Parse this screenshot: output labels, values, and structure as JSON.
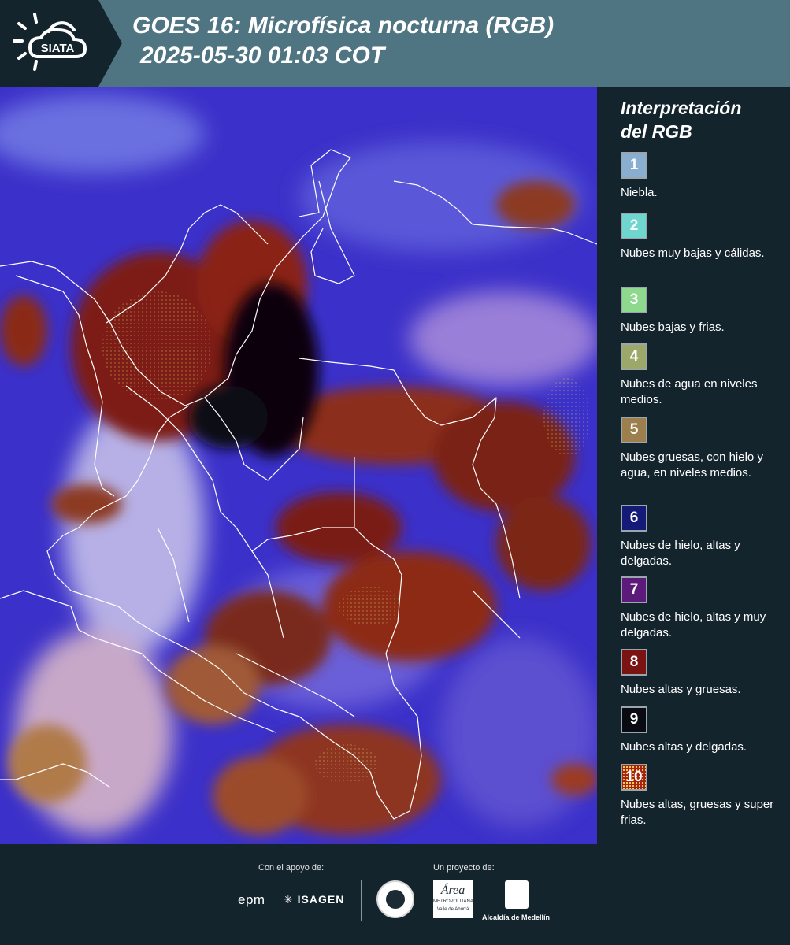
{
  "header": {
    "logo_text": "SIATA",
    "title_line1": "GOES 16: Microfísica nocturna (RGB)",
    "title_line2": "2025-05-30 01:03 COT"
  },
  "legend": {
    "title_line1": "Interpretación",
    "title_line2": "del RGB",
    "items": [
      {
        "num": "1",
        "color": "#8aaed0",
        "text": "Niebla."
      },
      {
        "num": "2",
        "color": "#6fd6cf",
        "text": "Nubes muy bajas y cálidas."
      },
      {
        "num": "3",
        "color": "#8ed98e",
        "text": "Nubes bajas y frias."
      },
      {
        "num": "4",
        "color": "#9ca86a",
        "text": "Nubes de agua en niveles medios."
      },
      {
        "num": "5",
        "color": "#9c7f4c",
        "text": "Nubes gruesas, con hielo y agua, en niveles medios."
      },
      {
        "num": "6",
        "color": "#141a78",
        "text": "Nubes de hielo, altas y delgadas."
      },
      {
        "num": "7",
        "color": "#5c1a7a",
        "text": "Nubes de hielo, altas y muy delgadas."
      },
      {
        "num": "8",
        "color": "#7a1412",
        "text": "Nubes altas y gruesas."
      },
      {
        "num": "9",
        "color": "#0a0a12",
        "text": "Nubes altas y delgadas."
      },
      {
        "num": "10",
        "color": "#a4241a",
        "text": "Nubes altas, gruesas y super frias."
      }
    ]
  },
  "footer": {
    "support_label": "Con el apoyo de:",
    "project_label": "Un proyecto de:",
    "epm": "epm",
    "isagen": "ISAGEN",
    "area_top": "Área",
    "area_sub": "METROPOLITANA",
    "area_sub2": "Valle de Aburrá",
    "alcaldia": "Alcaldía de Medellín"
  }
}
